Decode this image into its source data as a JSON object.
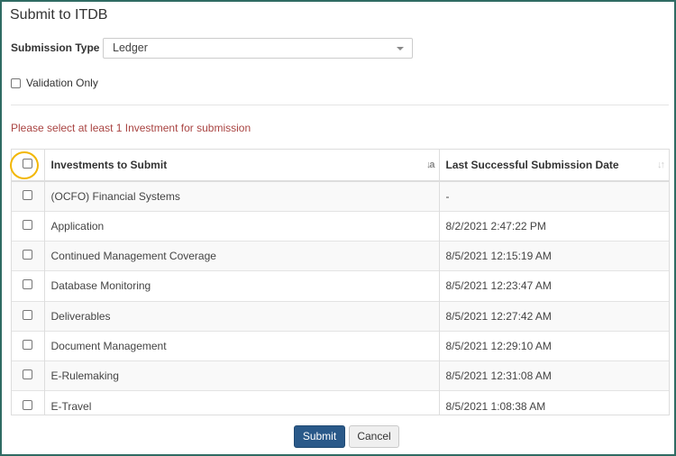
{
  "dialog": {
    "title": "Submit to ITDB"
  },
  "form": {
    "submission_type_label": "Submission Type",
    "submission_type_value": "Ledger",
    "validation_only_label": "Validation Only",
    "warning": "Please select at least 1 Investment for submission"
  },
  "table": {
    "columns": [
      "Investments to Submit",
      "Last Successful Submission Date"
    ],
    "rows": [
      {
        "investment": "(OCFO) Financial Systems",
        "date": "-"
      },
      {
        "investment": "Application",
        "date": "8/2/2021 2:47:22 PM"
      },
      {
        "investment": "Continued Management Coverage",
        "date": "8/5/2021 12:15:19 AM"
      },
      {
        "investment": "Database Monitoring",
        "date": "8/5/2021 12:23:47 AM"
      },
      {
        "investment": "Deliverables",
        "date": "8/5/2021 12:27:42 AM"
      },
      {
        "investment": "Document Management",
        "date": "8/5/2021 12:29:10 AM"
      },
      {
        "investment": "E-Rulemaking",
        "date": "8/5/2021 12:31:08 AM"
      },
      {
        "investment": "E-Travel",
        "date": "8/5/2021 1:08:38 AM"
      }
    ]
  },
  "buttons": {
    "submit": "Submit",
    "cancel": "Cancel"
  },
  "colors": {
    "warning": "#a94442",
    "primary": "#2a5989",
    "highlight": "#f2b705",
    "frame": "#2f6b63"
  },
  "icons": {
    "sort_active": "sort-alpha-icon",
    "sort_inactive": "sort-icon",
    "dropdown": "chevron-down-icon"
  }
}
